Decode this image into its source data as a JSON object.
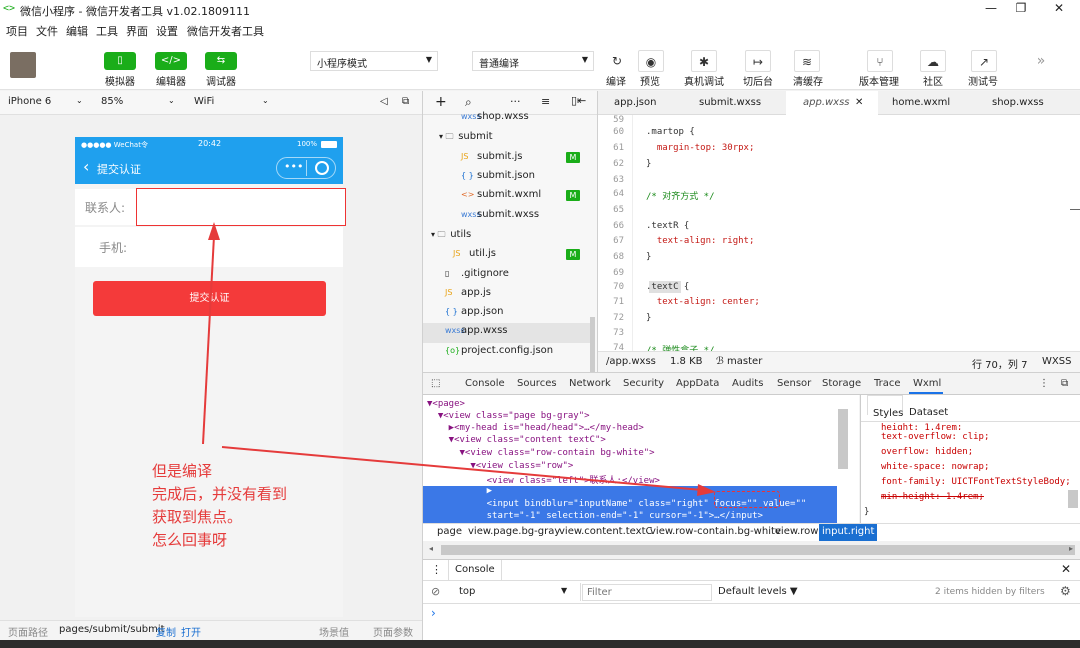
{
  "window": {
    "title": "微信小程序 - 微信开发者工具 v1.02.1809111",
    "logo": "<>"
  },
  "menu": [
    "项目",
    "文件",
    "编辑",
    "工具",
    "界面",
    "设置",
    "微信开发者工具"
  ],
  "toolbar": {
    "buttons": [
      {
        "label": "模拟器",
        "icon": "phone-icon"
      },
      {
        "label": "编辑器",
        "icon": "code-icon"
      },
      {
        "label": "调试器",
        "icon": "debug-icon"
      }
    ],
    "mode": "小程序模式",
    "compile": "普通编译",
    "actions": [
      {
        "label": "编译",
        "icon": "refresh-icon",
        "glyph": "↻"
      },
      {
        "label": "预览",
        "icon": "eye-icon",
        "glyph": "◉"
      },
      {
        "label": "真机调试",
        "icon": "bug-icon",
        "glyph": "✱"
      },
      {
        "label": "切后台",
        "icon": "background-icon",
        "glyph": "↦"
      },
      {
        "label": "清缓存",
        "icon": "layers-icon",
        "glyph": "≋"
      },
      {
        "label": "版本管理",
        "icon": "branch-icon",
        "glyph": "⑂"
      },
      {
        "label": "社区",
        "icon": "community-icon",
        "glyph": "☁"
      },
      {
        "label": "测试号",
        "icon": "external-icon",
        "glyph": "↗"
      }
    ],
    "more": "»"
  },
  "device": {
    "model": "iPhone 6",
    "zoom": "85%",
    "network": "WiFi"
  },
  "sim": {
    "status_left": "●●●●● WeChat令",
    "status_time": "20:42",
    "status_right": "100%",
    "nav_title": "提交认证",
    "back": "‹",
    "capsule": "•••",
    "contact_label": "联系人:",
    "phone_label": "手机:",
    "submit": "提交认证",
    "annotation": [
      "但是编译",
      "完成后，并没有看到",
      "获取到焦点。",
      "怎么回事呀"
    ]
  },
  "sim_status": {
    "path_label": "页面路径",
    "path": "pages/submit/submit",
    "copy": "复制",
    "open": "打开",
    "scene": "场景值",
    "params": "页面参数"
  },
  "files": [
    {
      "name": "shop.wxss",
      "type": "wxss"
    },
    {
      "name": "submit",
      "type": "folder"
    },
    {
      "name": "submit.js",
      "type": "js",
      "badge": "M"
    },
    {
      "name": "submit.json",
      "type": "json"
    },
    {
      "name": "submit.wxml",
      "type": "wxml",
      "badge": "M"
    },
    {
      "name": "submit.wxss",
      "type": "wxss"
    },
    {
      "name": "utils",
      "type": "folder"
    },
    {
      "name": "util.js",
      "type": "js",
      "badge": "M"
    },
    {
      "name": ".gitignore",
      "type": "file"
    },
    {
      "name": "app.js",
      "type": "js"
    },
    {
      "name": "app.json",
      "type": "json"
    },
    {
      "name": "app.wxss",
      "type": "wxss"
    },
    {
      "name": "project.config.json",
      "type": "config"
    }
  ],
  "tabs": [
    "app.json",
    "submit.wxss",
    "app.wxss",
    "home.wxml",
    "shop.wxss"
  ],
  "code": [
    {
      "n": "59",
      "t": ""
    },
    {
      "n": "60",
      "t": ".martop {"
    },
    {
      "n": "61",
      "t": "  margin-top: 30rpx;"
    },
    {
      "n": "62",
      "t": "}"
    },
    {
      "n": "63",
      "t": ""
    },
    {
      "n": "64",
      "t": "/* 对齐方式 */"
    },
    {
      "n": "65",
      "t": ""
    },
    {
      "n": "66",
      "t": ".textR {"
    },
    {
      "n": "67",
      "t": "  text-align: right;"
    },
    {
      "n": "68",
      "t": "}"
    },
    {
      "n": "69",
      "t": ""
    },
    {
      "n": "70",
      "t": ".textC {"
    },
    {
      "n": "71",
      "t": "  text-align: center;"
    },
    {
      "n": "72",
      "t": "}"
    },
    {
      "n": "73",
      "t": ""
    },
    {
      "n": "74",
      "t": "/* 弹性盒子 */"
    }
  ],
  "editor_status": {
    "file": "/app.wxss",
    "size": "1.8 KB",
    "branch": "ℬ master",
    "pos": "行 70，列 7",
    "lang": "WXSS"
  },
  "devtools_tabs": [
    "Console",
    "Sources",
    "Network",
    "Security",
    "AppData",
    "Audits",
    "Sensor",
    "Storage",
    "Trace",
    "Wxml"
  ],
  "wxml": [
    "▼<page>",
    "  ▼<view class=\"page bg-gray\">",
    "    ▶<my-head is=\"head/head\">…</my-head>",
    "    ▼<view class=\"content textC\">",
    "      ▼<view class=\"row-contain bg-white\">",
    "        ▼<view class=\"row\">",
    "           <view class=\"left\">联系人:</view>",
    "           ▶",
    "           <input bindblur=\"inputName\" class=\"right\" focus=\"\" value=\"\"",
    "           start=\"-1\" selection-end=\"-1\" cursor=\"-1\">…</input>"
  ],
  "styles_tabs": [
    "Styles",
    "Dataset"
  ],
  "styles": [
    "height: 1.4rem;",
    "text-overflow: clip;",
    "overflow: hidden;",
    "white-space: nowrap;",
    "font-family: UICTFontTextStyleBody;",
    "min-height: 1.4rem;",
    "}"
  ],
  "crumbs": [
    "page",
    "view.page.bg-gray",
    "view.content.textC",
    "view.row-contain.bg-white",
    "view.row",
    "input.right"
  ],
  "console": {
    "tab": "Console",
    "context": "top",
    "filter_placeholder": "Filter",
    "levels": "Default levels ▼",
    "hidden": "2 items hidden by filters",
    "prompt": "›"
  }
}
